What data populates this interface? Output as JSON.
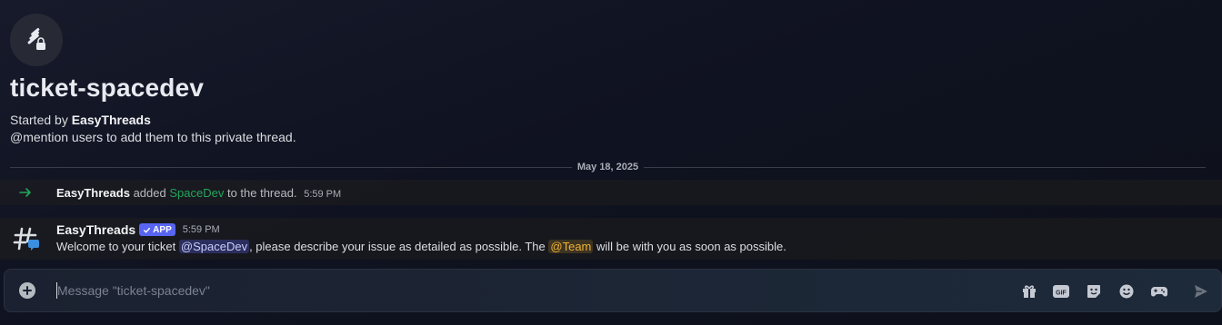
{
  "thread": {
    "title": "ticket-spacedev",
    "started_by_prefix": "Started by",
    "started_by_name": "EasyThreads",
    "hint": "@mention users to add them to this private thread.",
    "icon": "thread-lock-icon"
  },
  "divider": {
    "date": "May 18, 2025"
  },
  "system_message": {
    "icon": "join-arrow-icon",
    "actor": "EasyThreads",
    "verb": "added",
    "target": "SpaceDev",
    "suffix": "to the thread.",
    "time": "5:59 PM"
  },
  "message": {
    "author": "EasyThreads",
    "badge": "APP",
    "time": "5:59 PM",
    "avatar": "hash-bubble-icon",
    "text_1": "Welcome to your ticket",
    "mention_user": "@SpaceDev",
    "text_2": ", please describe your issue as detailed as possible. The",
    "mention_role": "@Team",
    "text_3": "will be with you as soon as possible."
  },
  "composer": {
    "placeholder": "Message \"ticket-spacedev\"",
    "value": "",
    "tools": [
      "gift-icon",
      "gif-icon",
      "sticker-icon",
      "emoji-icon",
      "activity-icon",
      "send-icon"
    ]
  },
  "colors": {
    "accent": "#5865f2",
    "joined": "#23a55a",
    "role_mention": "#f0b232"
  }
}
